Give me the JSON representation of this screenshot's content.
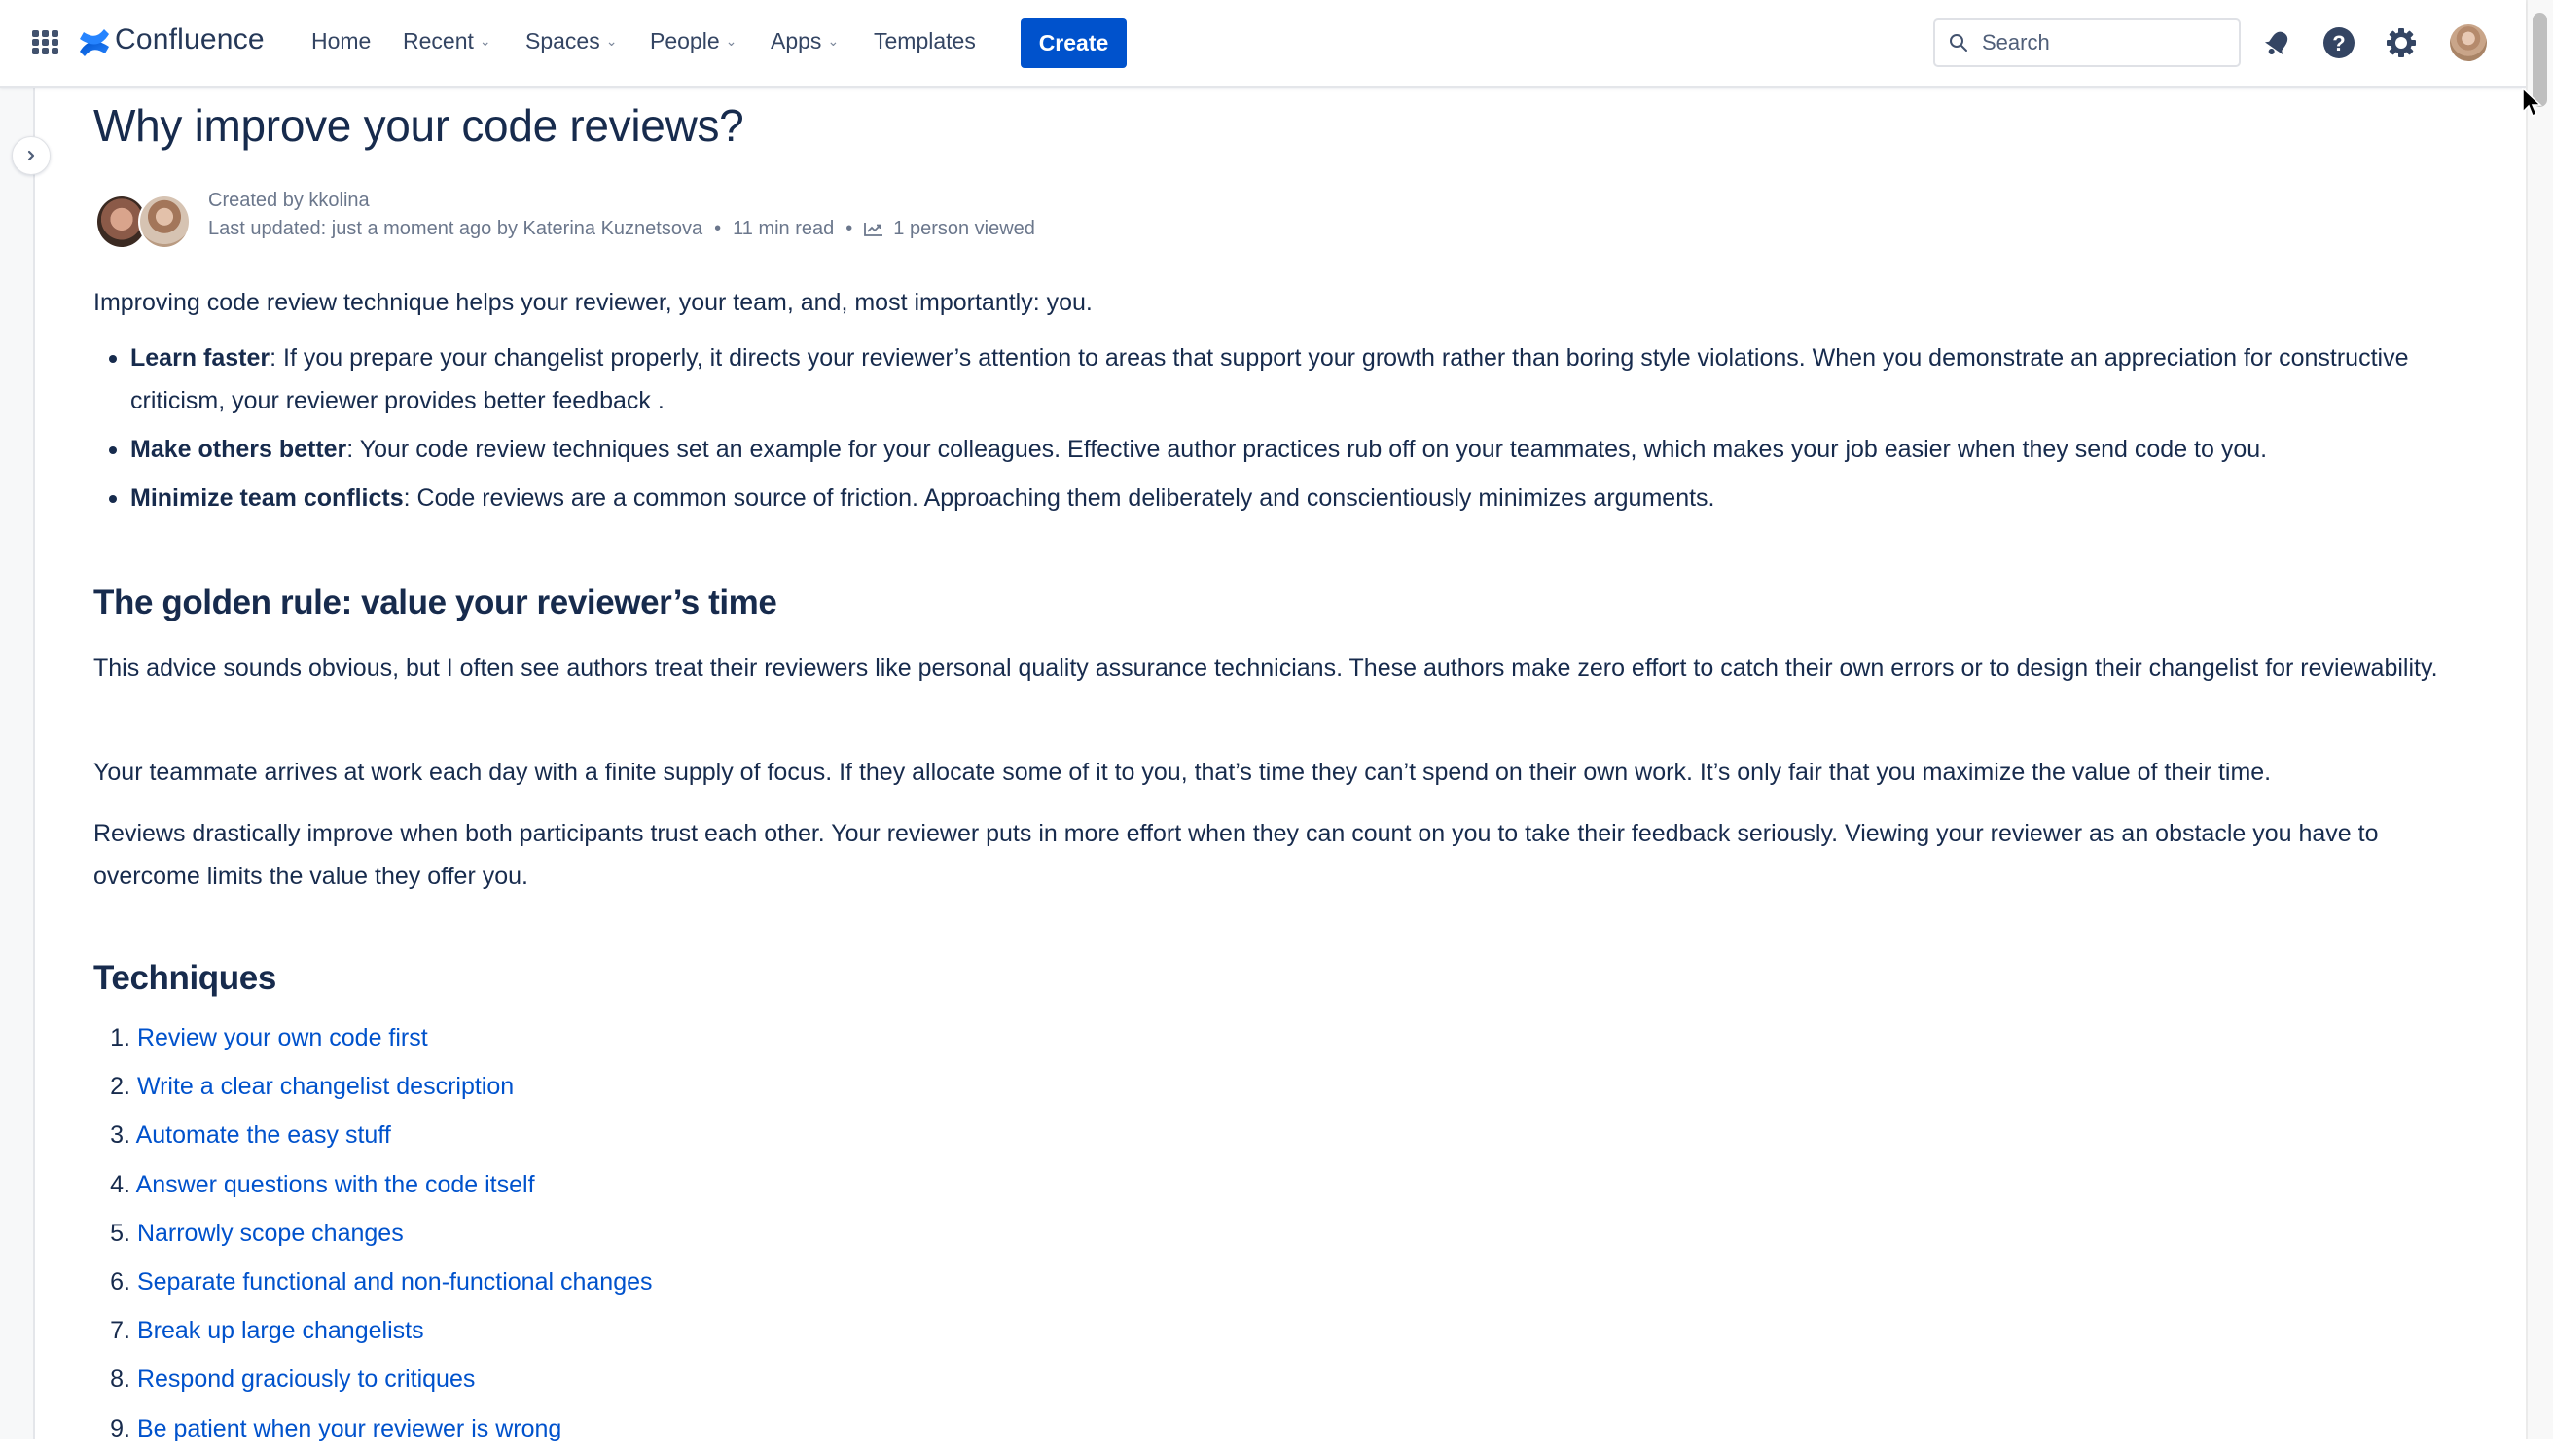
{
  "header": {
    "app_name": "Confluence",
    "nav": [
      {
        "label": "Home",
        "has_dropdown": false
      },
      {
        "label": "Recent",
        "has_dropdown": true
      },
      {
        "label": "Spaces",
        "has_dropdown": true
      },
      {
        "label": "People",
        "has_dropdown": true
      },
      {
        "label": "Apps",
        "has_dropdown": true
      },
      {
        "label": "Templates",
        "has_dropdown": false
      }
    ],
    "create_label": "Create",
    "search_placeholder": "Search",
    "icons": [
      "app-switcher-icon",
      "confluence-logo-icon",
      "notifications-icon",
      "help-icon",
      "settings-icon",
      "profile-avatar"
    ],
    "accent_color": "#0052cc"
  },
  "page": {
    "title": "Why improve your code reviews?",
    "meta": {
      "created_by": "Created by kkolina",
      "last_updated": "Last updated: just a moment ago by Katerina Kuznetsova",
      "read_time": "11 min read",
      "views": "1 person viewed",
      "separator": "•"
    },
    "intro": "Improving code review technique helps your reviewer, your team, and, most importantly: you.",
    "benefits": [
      {
        "term": "Learn faster",
        "text": ": If you prepare your changelist properly, it directs your reviewer’s attention to areas that support your growth rather than boring style violations. When you demonstrate an appreciation for constructive criticism, your reviewer provides better feedback ."
      },
      {
        "term": "Make others better",
        "text": ": Your code review techniques set an example for your colleagues. Effective author practices rub off on your teammates, which makes your job easier when they send code to you."
      },
      {
        "term": "Minimize team conflicts",
        "text": ": Code reviews are a common source of friction. Approaching them deliberately and conscientiously minimizes arguments."
      }
    ],
    "golden_rule": {
      "heading": "The golden rule: value your reviewer’s time",
      "paragraphs": [
        "This advice sounds obvious, but I often see authors treat their reviewers like personal quality assurance technicians. These authors make zero effort to catch their own errors or to design their changelist for reviewability.",
        "Your teammate arrives at work each day with a finite supply of focus. If they allocate some of it to you, that’s time they can’t spend on their own work. It’s only fair that you maximize the value of their time.",
        "Reviews drastically improve when both participants trust each other. Your reviewer puts in more effort when they can count on you to take their feedback seriously. Viewing your reviewer as an obstacle you have to overcome limits the value they offer you."
      ]
    },
    "techniques": {
      "heading": "Techniques",
      "items": [
        {
          "num": "1.",
          "label": "Review your own code first"
        },
        {
          "num": "2.",
          "label": "Write a clear changelist description"
        },
        {
          "num": "3.",
          "label": "Automate the easy stuff"
        },
        {
          "num": "4.",
          "label": "Answer questions with the code itself"
        },
        {
          "num": "5.",
          "label": "Narrowly scope changes"
        },
        {
          "num": "6.",
          "label": "Separate functional and non-functional changes"
        },
        {
          "num": "7.",
          "label": "Break up large changelists"
        },
        {
          "num": "8.",
          "label": "Respond graciously to critiques"
        },
        {
          "num": "9.",
          "label": "Be patient when your reviewer is wrong"
        }
      ]
    }
  }
}
